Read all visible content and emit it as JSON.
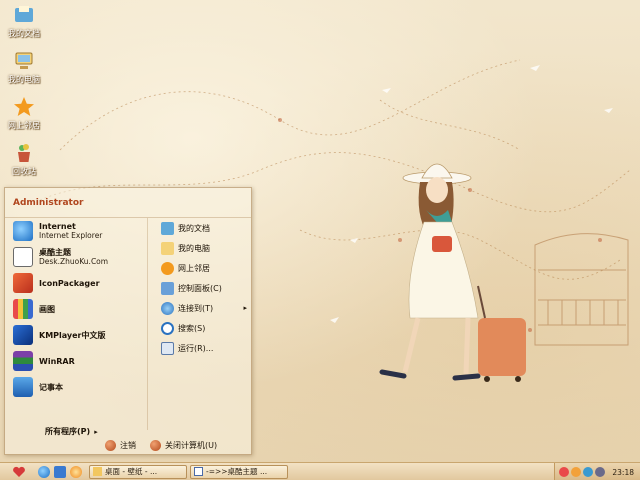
{
  "desktop": {
    "icons": [
      {
        "label": "我的文档",
        "icon": "my-documents-icon"
      },
      {
        "label": "我的电脑",
        "icon": "my-computer-icon"
      },
      {
        "label": "网上邻居",
        "icon": "network-places-icon"
      },
      {
        "label": "回收站",
        "icon": "recycle-bin-icon"
      }
    ]
  },
  "start_menu": {
    "user": "Administrator",
    "pinned": [
      {
        "title": "Internet",
        "subtitle": "Internet Explorer",
        "icon": "internet-explorer-icon"
      },
      {
        "title": "桌酷主题",
        "subtitle": "Desk.ZhuoKu.Com",
        "icon": "zhuoku-theme-icon"
      },
      {
        "title": "IconPackager",
        "subtitle": "",
        "icon": "iconpackager-icon"
      },
      {
        "title": "画图",
        "subtitle": "",
        "icon": "paint-icon"
      },
      {
        "title": "KMPlayer中文版",
        "subtitle": "",
        "icon": "kmplayer-icon"
      },
      {
        "title": "WinRAR",
        "subtitle": "",
        "icon": "winrar-icon"
      },
      {
        "title": "记事本",
        "subtitle": "",
        "icon": "notepad-icon"
      }
    ],
    "places": [
      {
        "label": "我的文档",
        "icon": "my-documents-icon"
      },
      {
        "label": "我的电脑",
        "icon": "my-computer-icon"
      },
      {
        "label": "网上邻居",
        "icon": "network-places-icon"
      },
      {
        "label": "控制面板(C)",
        "icon": "control-panel-icon"
      },
      {
        "label": "连接到(T)",
        "icon": "connect-to-icon",
        "arrow": "▸"
      },
      {
        "label": "搜索(S)",
        "icon": "search-icon"
      },
      {
        "label": "运行(R)...",
        "icon": "run-icon"
      }
    ],
    "all_programs": "所有程序(P)",
    "all_programs_arrow": "▸",
    "logoff": "注销",
    "shutdown": "关闭计算机(U)"
  },
  "taskbar": {
    "tasks": [
      {
        "label": "桌面 - 壁纸 - ...",
        "icon": "folder-icon"
      },
      {
        "label": "-=>>桌酷主题 ...",
        "icon": "window-icon"
      }
    ],
    "clock": "23:18"
  },
  "colors": {
    "accent": "#b0461e",
    "wallpaper": "#efe2c6",
    "taskbar": "#e2c89e"
  }
}
